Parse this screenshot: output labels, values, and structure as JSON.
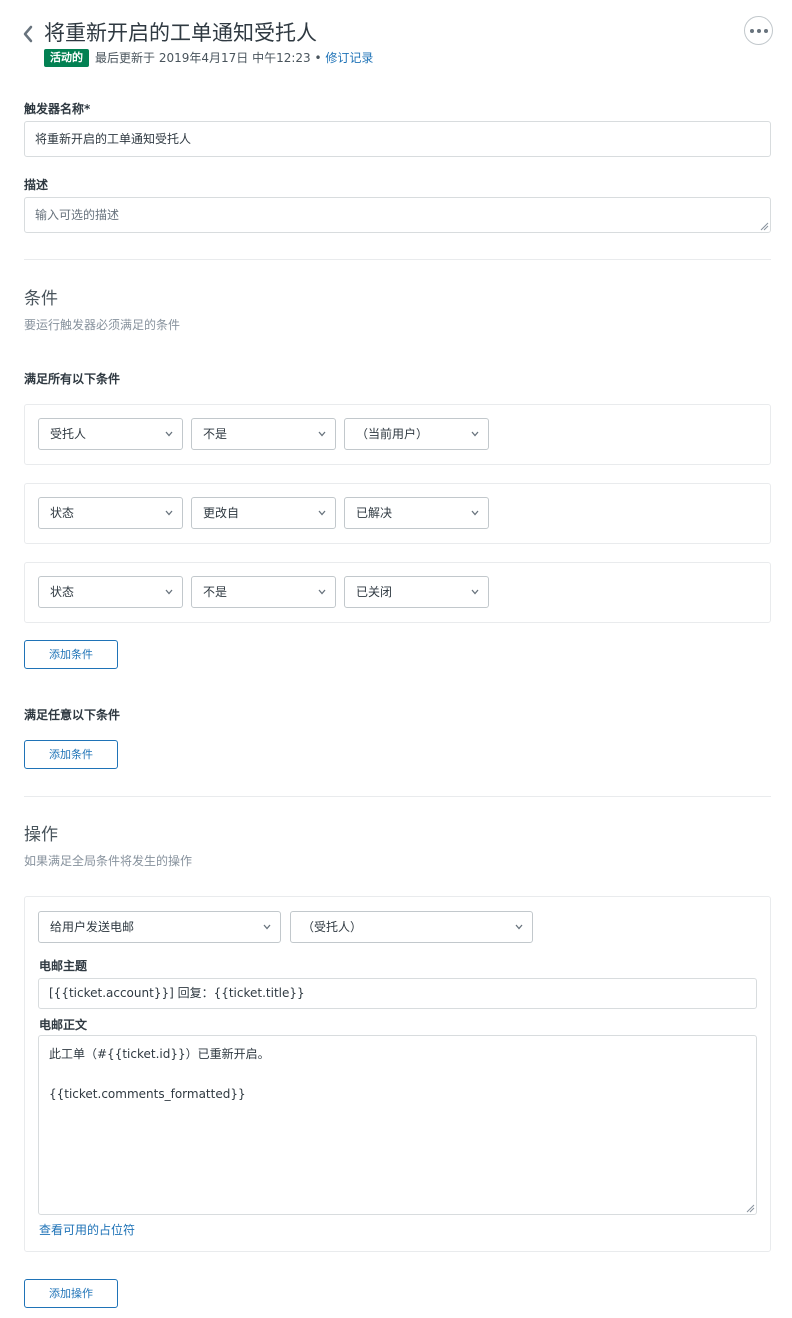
{
  "header": {
    "title": "将重新开启的工单通知受托人",
    "status_badge": "活动的",
    "updated_text": "最后更新于 2019年4月17日 中午12:23 •",
    "revisions_link": "修订记录"
  },
  "fields": {
    "name_label": "触发器名称*",
    "name_value": "将重新开启的工单通知受托人",
    "description_label": "描述",
    "description_placeholder": "输入可选的描述"
  },
  "conditions": {
    "heading": "条件",
    "subheading": "要运行触发器必须满足的条件",
    "all_label": "满足所有以下条件",
    "rows": [
      {
        "field": "受托人",
        "operator": "不是",
        "value": "（当前用户）"
      },
      {
        "field": "状态",
        "operator": "更改自",
        "value": "已解决"
      },
      {
        "field": "状态",
        "operator": "不是",
        "value": "已关闭"
      }
    ],
    "add_all_button": "添加条件",
    "any_label": "满足任意以下条件",
    "add_any_button": "添加条件"
  },
  "actions": {
    "heading": "操作",
    "subheading": "如果满足全局条件将发生的操作",
    "action_type": "给用户发送电邮",
    "action_target": "（受托人）",
    "subject_label": "电邮主题",
    "subject_value": "[{{ticket.account}}] 回复：{{ticket.title}}",
    "body_label": "电邮正文",
    "body_line1": "此工单（#{{ticket.id}}）已重新开启。",
    "body_line2": "{{ticket.comments_formatted}}",
    "placeholders_link": "查看可用的占位符",
    "add_action_button": "添加操作"
  }
}
